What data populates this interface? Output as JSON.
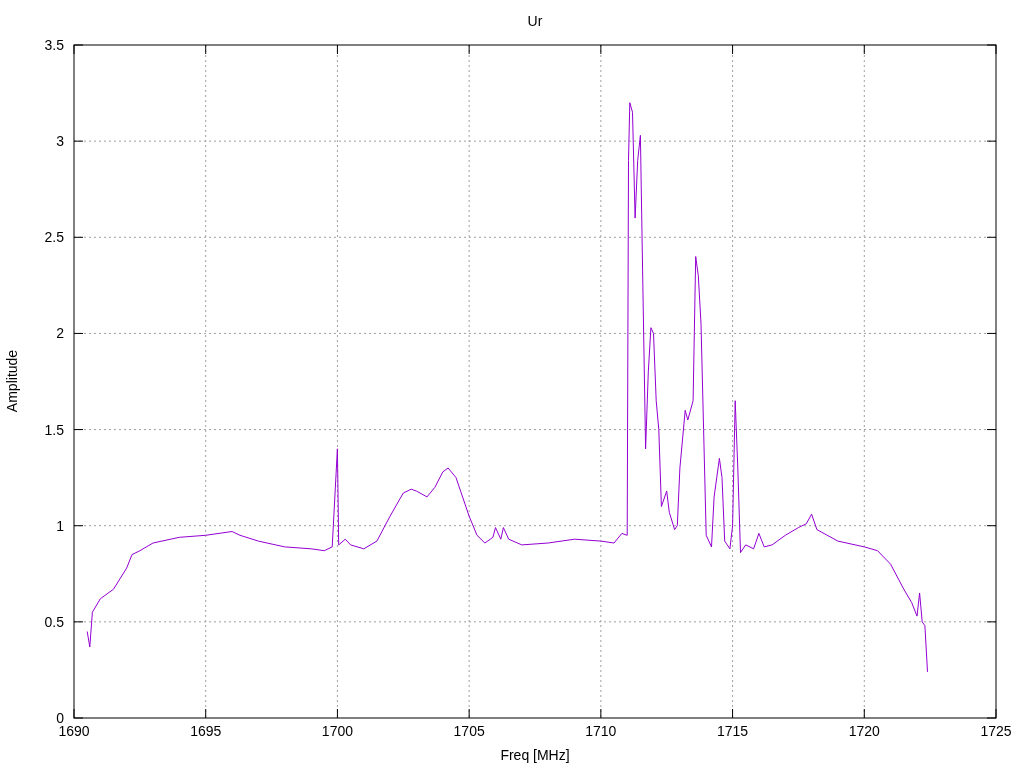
{
  "chart_data": {
    "type": "line",
    "grid": true,
    "title": "Ur",
    "xlabel": "Freq [MHz]",
    "ylabel": "Amplitude",
    "xlim": [
      1690,
      1725
    ],
    "ylim": [
      0,
      3.5
    ],
    "xticks": [
      1690,
      1695,
      1700,
      1705,
      1710,
      1715,
      1720,
      1725
    ],
    "yticks": [
      0,
      0.5,
      1,
      1.5,
      2,
      2.5,
      3,
      3.5
    ],
    "x": [
      1690.5,
      1690.6,
      1690.7,
      1691,
      1691.5,
      1692,
      1692.2,
      1692.5,
      1693,
      1694,
      1695,
      1696,
      1696.3,
      1697,
      1698,
      1699,
      1699.5,
      1699.8,
      1700,
      1700.05,
      1700.3,
      1700.5,
      1701,
      1701.5,
      1702,
      1702.5,
      1702.8,
      1703,
      1703.4,
      1703.7,
      1704,
      1704.2,
      1704.5,
      1705,
      1705.3,
      1705.6,
      1705.9,
      1706,
      1706.2,
      1706.3,
      1706.5,
      1707,
      1708,
      1709,
      1710,
      1710.5,
      1710.8,
      1711,
      1711.05,
      1711.1,
      1711.2,
      1711.3,
      1711.4,
      1711.5,
      1711.6,
      1711.7,
      1711.8,
      1711.9,
      1712,
      1712.1,
      1712.2,
      1712.3,
      1712.5,
      1712.6,
      1712.8,
      1712.9,
      1713,
      1713.2,
      1713.3,
      1713.5,
      1713.6,
      1713.7,
      1713.8,
      1713.9,
      1714,
      1714.2,
      1714.3,
      1714.5,
      1714.6,
      1714.7,
      1714.9,
      1715,
      1715.1,
      1715.2,
      1715.3,
      1715.5,
      1715.8,
      1716,
      1716.2,
      1716.5,
      1717,
      1717.5,
      1717.8,
      1718,
      1718.2,
      1719,
      1720,
      1720.5,
      1721,
      1721.5,
      1721.8,
      1722,
      1722.1,
      1722.2,
      1722.3,
      1722.4
    ],
    "series": [
      {
        "color": "#9400d3",
        "values": [
          0.45,
          0.37,
          0.55,
          0.62,
          0.67,
          0.78,
          0.85,
          0.87,
          0.91,
          0.94,
          0.95,
          0.97,
          0.95,
          0.92,
          0.89,
          0.88,
          0.87,
          0.89,
          1.4,
          0.9,
          0.93,
          0.9,
          0.88,
          0.92,
          1.05,
          1.17,
          1.19,
          1.18,
          1.15,
          1.2,
          1.28,
          1.3,
          1.25,
          1.05,
          0.95,
          0.91,
          0.94,
          0.99,
          0.93,
          0.99,
          0.93,
          0.9,
          0.91,
          0.93,
          0.92,
          0.91,
          0.96,
          0.95,
          2.9,
          3.2,
          3.15,
          2.6,
          2.9,
          3.03,
          2.2,
          1.4,
          1.8,
          2.03,
          2.0,
          1.65,
          1.5,
          1.1,
          1.18,
          1.07,
          0.98,
          1.0,
          1.3,
          1.6,
          1.55,
          1.65,
          2.4,
          2.3,
          2.05,
          1.5,
          0.95,
          0.89,
          1.15,
          1.35,
          1.25,
          0.92,
          0.88,
          1.0,
          1.65,
          1.3,
          0.86,
          0.9,
          0.88,
          0.96,
          0.89,
          0.9,
          0.95,
          0.99,
          1.01,
          1.06,
          0.98,
          0.92,
          0.89,
          0.87,
          0.8,
          0.67,
          0.6,
          0.53,
          0.65,
          0.5,
          0.48,
          0.24
        ]
      }
    ]
  }
}
